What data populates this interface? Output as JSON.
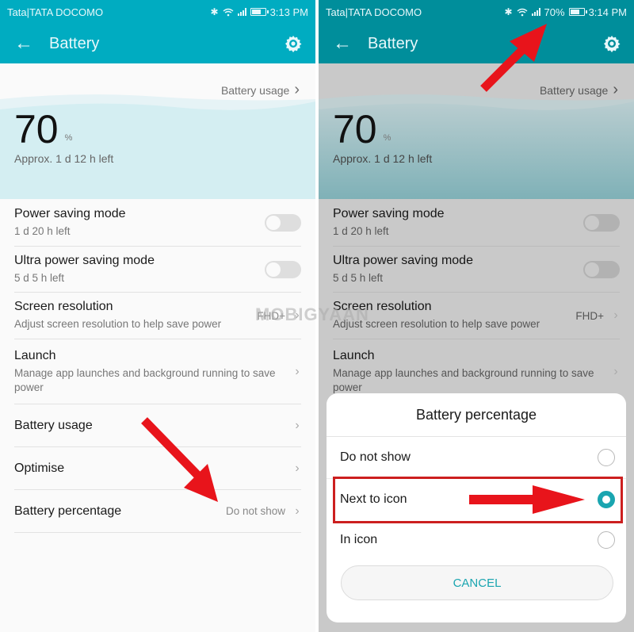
{
  "screens": [
    {
      "status": {
        "carrier": "Tata|TATA DOCOMO",
        "battery_percent_text": "",
        "time": "3:13 PM",
        "battery_level_pct": 70
      },
      "appbar": {
        "title": "Battery"
      },
      "hero": {
        "usage_link": "Battery usage",
        "percent": "70",
        "percent_sign": "%",
        "approx": "Approx. 1 d 12 h left"
      },
      "rows": {
        "power_saving": {
          "title": "Power saving mode",
          "sub": "1 d 20 h left",
          "on": false
        },
        "ultra_power_saving": {
          "title": "Ultra power saving mode",
          "sub": "5 d 5 h left",
          "on": false
        },
        "screen_resolution": {
          "title": "Screen resolution",
          "sub": "Adjust screen resolution to help save power",
          "value": "FHD+"
        },
        "launch": {
          "title": "Launch",
          "sub": "Manage app launches and background running to save power"
        },
        "battery_usage": {
          "title": "Battery usage"
        },
        "optimise": {
          "title": "Optimise"
        },
        "battery_percentage": {
          "title": "Battery percentage",
          "value": "Do not show"
        }
      }
    },
    {
      "status": {
        "carrier": "Tata|TATA DOCOMO",
        "battery_percent_text": "70%",
        "time": "3:14 PM",
        "battery_level_pct": 70
      },
      "appbar": {
        "title": "Battery"
      },
      "hero": {
        "usage_link": "Battery usage",
        "percent": "70",
        "percent_sign": "%",
        "approx": "Approx. 1 d 12 h left"
      },
      "rows": {
        "power_saving": {
          "title": "Power saving mode",
          "sub": "1 d 20 h left",
          "on": false
        },
        "ultra_power_saving": {
          "title": "Ultra power saving mode",
          "sub": "5 d 5 h left",
          "on": false
        },
        "screen_resolution": {
          "title": "Screen resolution",
          "sub": "Adjust screen resolution to help save power",
          "value": "FHD+"
        },
        "launch": {
          "title": "Launch",
          "sub": "Manage app launches and background running to save power"
        }
      },
      "dialog": {
        "title": "Battery percentage",
        "options": [
          {
            "label": "Do not show",
            "selected": false
          },
          {
            "label": "Next to icon",
            "selected": true
          },
          {
            "label": "In icon",
            "selected": false
          }
        ],
        "cancel_label": "CANCEL"
      }
    }
  ],
  "icons": {
    "back": "←",
    "chevron": "›",
    "bluetooth": "✱",
    "wifi": "wifi-icon"
  },
  "watermark": "MOBIGYAAN",
  "colors": {
    "appbar_left": "#00acc1",
    "appbar_right_dimmed": "#008e9b",
    "accent": "#1aa5b0",
    "annotation_red": "#e8141b"
  }
}
